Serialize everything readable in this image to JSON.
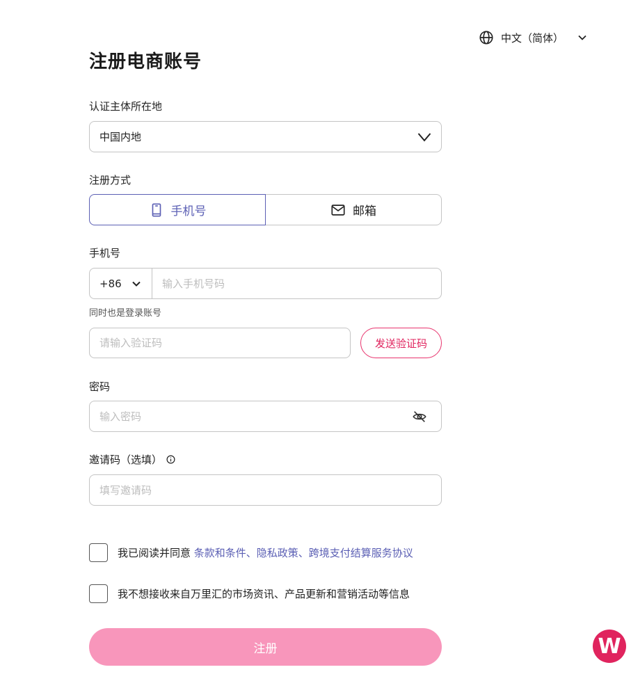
{
  "language": {
    "label": "中文（简体）"
  },
  "page": {
    "title": "注册电商账号"
  },
  "region": {
    "label": "认证主体所在地",
    "value": "中国内地"
  },
  "register_method": {
    "label": "注册方式",
    "options": [
      {
        "label": "手机号",
        "icon": "phone-icon",
        "selected": true
      },
      {
        "label": "邮箱",
        "icon": "mail-icon",
        "selected": false
      }
    ]
  },
  "phone": {
    "label": "手机号",
    "country_code": "+86",
    "placeholder": "输入手机号码",
    "hint": "同时也是登录账号"
  },
  "verification": {
    "placeholder": "请输入验证码",
    "send_button": "发送验证码"
  },
  "password": {
    "label": "密码",
    "placeholder": "输入密码"
  },
  "invite": {
    "label": "邀请码（选填）",
    "placeholder": "填写邀请码"
  },
  "agreement": {
    "prefix": "我已阅读并同意 ",
    "links": "条款和条件、隐私政策、跨境支付结算服务协议",
    "checked": false
  },
  "marketing_optout": {
    "text": "我不想接收来自万里汇的市场资讯、产品更新和营销活动等信息",
    "checked": false
  },
  "submit": {
    "label": "注册"
  },
  "logo": {
    "letter": "W"
  },
  "colors": {
    "accent": "#5b5fb4",
    "brand": "#e0245e",
    "submit_bg": "#f896bb",
    "border": "#c4c4c4"
  }
}
